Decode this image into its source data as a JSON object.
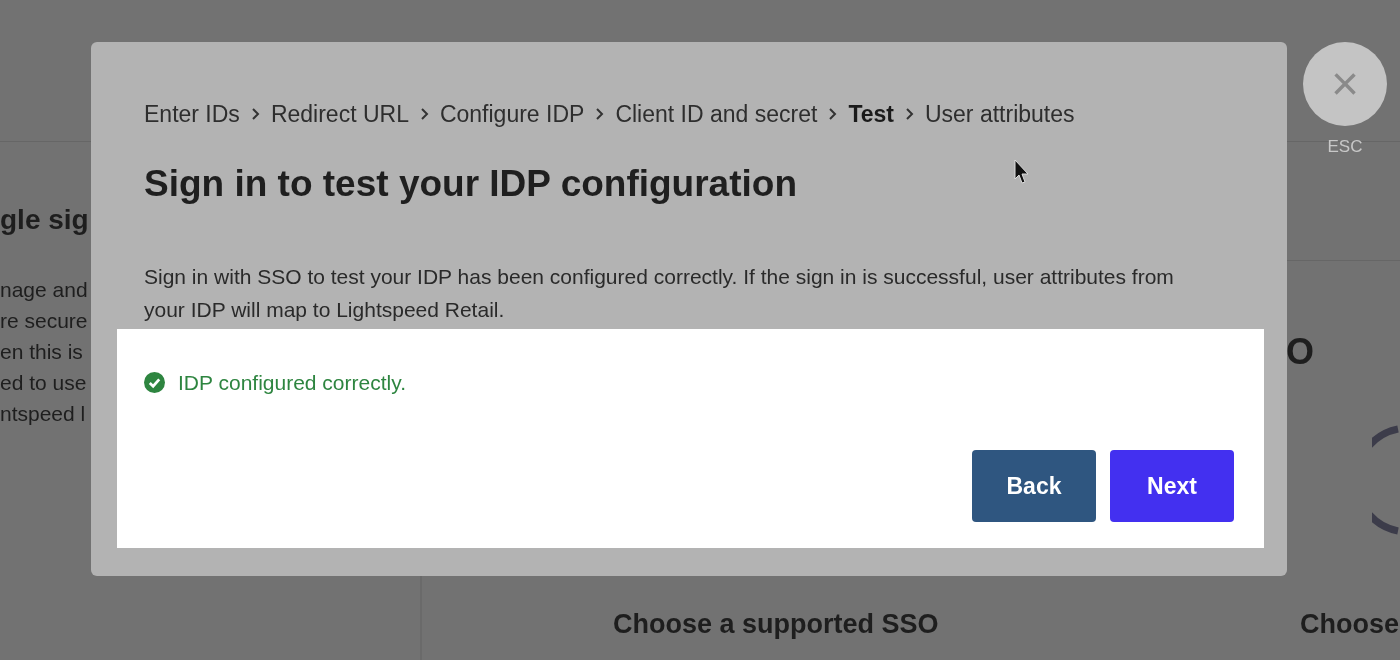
{
  "background": {
    "left_heading": "gle sig",
    "left_lines": [
      "nage and",
      "re secure",
      "en this is",
      "ed to use",
      "ntspeed l"
    ],
    "right_heading": "O",
    "bottom_cards": [
      "Choose a supported SSO",
      "Choose"
    ]
  },
  "close": {
    "icon": "×",
    "label": "ESC"
  },
  "modal": {
    "breadcrumb": [
      {
        "label": "Enter IDs",
        "current": false
      },
      {
        "label": "Redirect URL",
        "current": false
      },
      {
        "label": "Configure IDP",
        "current": false
      },
      {
        "label": "Client ID and secret",
        "current": false
      },
      {
        "label": "Test",
        "current": true
      },
      {
        "label": "User attributes",
        "current": false
      }
    ],
    "title": "Sign in to test your IDP configuration",
    "description": "Sign in with SSO to test your IDP has been configured correctly. If the sign in is successful, user attributes from your IDP will map to Lightspeed Retail.",
    "status": {
      "kind": "success",
      "message": "IDP configured correctly."
    },
    "buttons": [
      {
        "kind": "secondary",
        "label": "Back"
      },
      {
        "kind": "primary",
        "label": "Next"
      }
    ]
  }
}
